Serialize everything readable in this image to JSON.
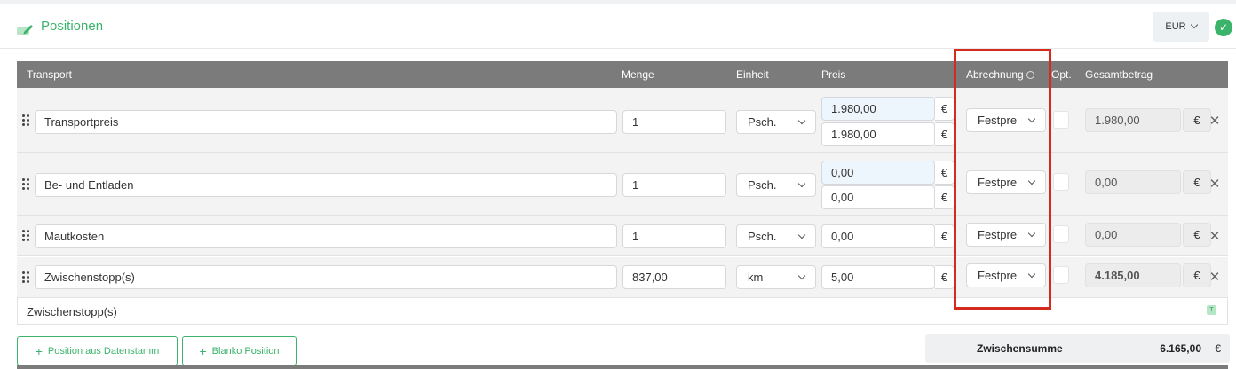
{
  "section": {
    "title": "Positionen",
    "currency": "EUR"
  },
  "columns": {
    "transport": "Transport",
    "menge": "Menge",
    "einheit": "Einheit",
    "preis": "Preis",
    "abrechnung": "Abrechnung",
    "opt": "Opt.",
    "gesamtbetrag": "Gesamtbetrag"
  },
  "rows": [
    {
      "name": "Transportpreis",
      "menge": "1",
      "einheit": "Psch.",
      "preis_1": "1.980,00",
      "preis_2": "1.980,00",
      "abrechnung": "Festpre",
      "gesamt": "1.980,00"
    },
    {
      "name": "Be- und Entladen",
      "menge": "1",
      "einheit": "Psch.",
      "preis_1": "0,00",
      "preis_2": "0,00",
      "abrechnung": "Festpre",
      "gesamt": "0,00"
    },
    {
      "name": "Mautkosten",
      "menge": "1",
      "einheit": "Psch.",
      "preis_1": "0,00",
      "abrechnung": "Festpre",
      "gesamt": "0,00"
    },
    {
      "name": "Zwischenstopp(s)",
      "menge": "837,00",
      "einheit": "km",
      "preis_1": "5,00",
      "abrechnung": "Festpre",
      "gesamt": "4.185,00"
    }
  ],
  "sub_label": "Zwischenstopp(s)",
  "sub_badge": "T",
  "currency_symbol": "€",
  "buttons": {
    "from_master": "Position aus Datenstamm",
    "blank": "Blanko Position"
  },
  "summary": {
    "label": "Zwischensumme",
    "value": "6.165,00",
    "currency": "€"
  },
  "colors": {
    "accent": "#3bb36b",
    "highlight": "#d42b1e",
    "header_bg": "#7b7b7b"
  }
}
